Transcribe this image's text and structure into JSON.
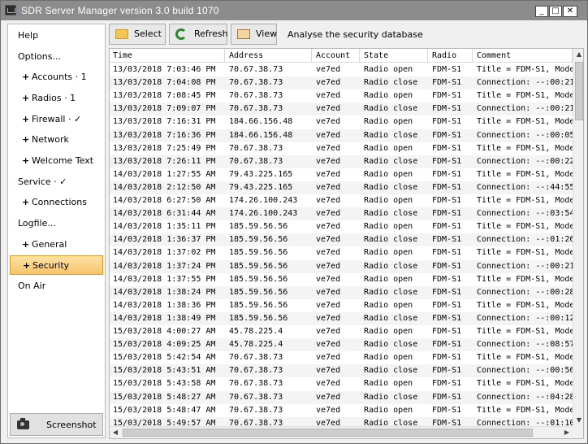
{
  "window": {
    "title": "SDR Server Manager version 3.0 build 1070",
    "min_glyph": "_",
    "max_glyph": "□",
    "close_glyph": "✕"
  },
  "sidebar": {
    "items": [
      {
        "label": "Help",
        "level": 0,
        "plus": false,
        "active": false
      },
      {
        "label": "Options...",
        "level": 0,
        "plus": false,
        "active": false
      },
      {
        "label": "Accounts · 1",
        "level": 1,
        "plus": true,
        "active": false
      },
      {
        "label": "Radios · 1",
        "level": 1,
        "plus": true,
        "active": false
      },
      {
        "label": "Firewall · ✓",
        "level": 1,
        "plus": true,
        "active": false
      },
      {
        "label": "Network",
        "level": 1,
        "plus": true,
        "active": false
      },
      {
        "label": "Welcome Text",
        "level": 1,
        "plus": true,
        "active": false
      },
      {
        "label": "Service · ✓",
        "level": 0,
        "plus": false,
        "active": false
      },
      {
        "label": "Connections",
        "level": 1,
        "plus": true,
        "active": false
      },
      {
        "label": "Logfile...",
        "level": 0,
        "plus": false,
        "active": false
      },
      {
        "label": "General",
        "level": 1,
        "plus": true,
        "active": false
      },
      {
        "label": "Security",
        "level": 1,
        "plus": true,
        "active": true
      },
      {
        "label": "On Air",
        "level": 0,
        "plus": false,
        "active": false
      }
    ],
    "screenshot_label": "Screenshot",
    "plus_glyph": "+"
  },
  "toolbar": {
    "select_label": "Select",
    "refresh_label": "Refresh",
    "view_label": "View",
    "caption": "Analyse the security database"
  },
  "table": {
    "columns": [
      "Time",
      "Address",
      "Account",
      "State",
      "Radio",
      "Comment"
    ],
    "rows": [
      [
        "13/03/2018 7:03:46 PM",
        "70.67.38.73",
        "ve7ed",
        "Radio open",
        "FDM-S1",
        "Title = FDM-S1, Mode"
      ],
      [
        "13/03/2018 7:04:08 PM",
        "70.67.38.73",
        "ve7ed",
        "Radio close",
        "FDM-S1",
        "Connection: --:00:21"
      ],
      [
        "13/03/2018 7:08:45 PM",
        "70.67.38.73",
        "ve7ed",
        "Radio open",
        "FDM-S1",
        "Title = FDM-S1, Mode"
      ],
      [
        "13/03/2018 7:09:07 PM",
        "70.67.38.73",
        "ve7ed",
        "Radio close",
        "FDM-S1",
        "Connection: --:00:21"
      ],
      [
        "13/03/2018 7:16:31 PM",
        "184.66.156.48",
        "ve7ed",
        "Radio open",
        "FDM-S1",
        "Title = FDM-S1, Mode"
      ],
      [
        "13/03/2018 7:16:36 PM",
        "184.66.156.48",
        "ve7ed",
        "Radio close",
        "FDM-S1",
        "Connection: --:00:05"
      ],
      [
        "13/03/2018 7:25:49 PM",
        "70.67.38.73",
        "ve7ed",
        "Radio open",
        "FDM-S1",
        "Title = FDM-S1, Mode"
      ],
      [
        "13/03/2018 7:26:11 PM",
        "70.67.38.73",
        "ve7ed",
        "Radio close",
        "FDM-S1",
        "Connection: --:00:22"
      ],
      [
        "14/03/2018 1:27:55 AM",
        "79.43.225.165",
        "ve7ed",
        "Radio open",
        "FDM-S1",
        "Title = FDM-S1, Mode"
      ],
      [
        "14/03/2018 2:12:50 AM",
        "79.43.225.165",
        "ve7ed",
        "Radio close",
        "FDM-S1",
        "Connection: --:44:55"
      ],
      [
        "14/03/2018 6:27:50 AM",
        "174.26.100.243",
        "ve7ed",
        "Radio open",
        "FDM-S1",
        "Title = FDM-S1, Mode"
      ],
      [
        "14/03/2018 6:31:44 AM",
        "174.26.100.243",
        "ve7ed",
        "Radio close",
        "FDM-S1",
        "Connection: --:03:54"
      ],
      [
        "14/03/2018 1:35:11 PM",
        "185.59.56.56",
        "ve7ed",
        "Radio open",
        "FDM-S1",
        "Title = FDM-S1, Mode"
      ],
      [
        "14/03/2018 1:36:37 PM",
        "185.59.56.56",
        "ve7ed",
        "Radio close",
        "FDM-S1",
        "Connection: --:01:26"
      ],
      [
        "14/03/2018 1:37:02 PM",
        "185.59.56.56",
        "ve7ed",
        "Radio open",
        "FDM-S1",
        "Title = FDM-S1, Mode"
      ],
      [
        "14/03/2018 1:37:24 PM",
        "185.59.56.56",
        "ve7ed",
        "Radio close",
        "FDM-S1",
        "Connection: --:00:21"
      ],
      [
        "14/03/2018 1:37:55 PM",
        "185.59.56.56",
        "ve7ed",
        "Radio open",
        "FDM-S1",
        "Title = FDM-S1, Mode"
      ],
      [
        "14/03/2018 1:38:24 PM",
        "185.59.56.56",
        "ve7ed",
        "Radio close",
        "FDM-S1",
        "Connection: --:00:28"
      ],
      [
        "14/03/2018 1:38:36 PM",
        "185.59.56.56",
        "ve7ed",
        "Radio open",
        "FDM-S1",
        "Title = FDM-S1, Mode"
      ],
      [
        "14/03/2018 1:38:49 PM",
        "185.59.56.56",
        "ve7ed",
        "Radio close",
        "FDM-S1",
        "Connection: --:00:12"
      ],
      [
        "15/03/2018 4:00:27 AM",
        "45.78.225.4",
        "ve7ed",
        "Radio open",
        "FDM-S1",
        "Title = FDM-S1, Mode"
      ],
      [
        "15/03/2018 4:09:25 AM",
        "45.78.225.4",
        "ve7ed",
        "Radio close",
        "FDM-S1",
        "Connection: --:08:57"
      ],
      [
        "15/03/2018 5:42:54 AM",
        "70.67.38.73",
        "ve7ed",
        "Radio open",
        "FDM-S1",
        "Title = FDM-S1, Mode"
      ],
      [
        "15/03/2018 5:43:51 AM",
        "70.67.38.73",
        "ve7ed",
        "Radio close",
        "FDM-S1",
        "Connection: --:00:56"
      ],
      [
        "15/03/2018 5:43:58 AM",
        "70.67.38.73",
        "ve7ed",
        "Radio open",
        "FDM-S1",
        "Title = FDM-S1, Mode"
      ],
      [
        "15/03/2018 5:48:27 AM",
        "70.67.38.73",
        "ve7ed",
        "Radio close",
        "FDM-S1",
        "Connection: --:04:28"
      ],
      [
        "15/03/2018 5:48:47 AM",
        "70.67.38.73",
        "ve7ed",
        "Radio open",
        "FDM-S1",
        "Title = FDM-S1, Mode"
      ],
      [
        "15/03/2018 5:49:57 AM",
        "70.67.38.73",
        "ve7ed",
        "Radio close",
        "FDM-S1",
        "Connection: --:01:10"
      ]
    ]
  },
  "scrollbar": {
    "up_glyph": "▲",
    "down_glyph": "▼",
    "left_glyph": "◀",
    "right_glyph": "▶"
  },
  "colors": {
    "titlebar": "#8c8c8c",
    "selection": "#f7c46a",
    "row_alt": "#f4f4f4"
  }
}
